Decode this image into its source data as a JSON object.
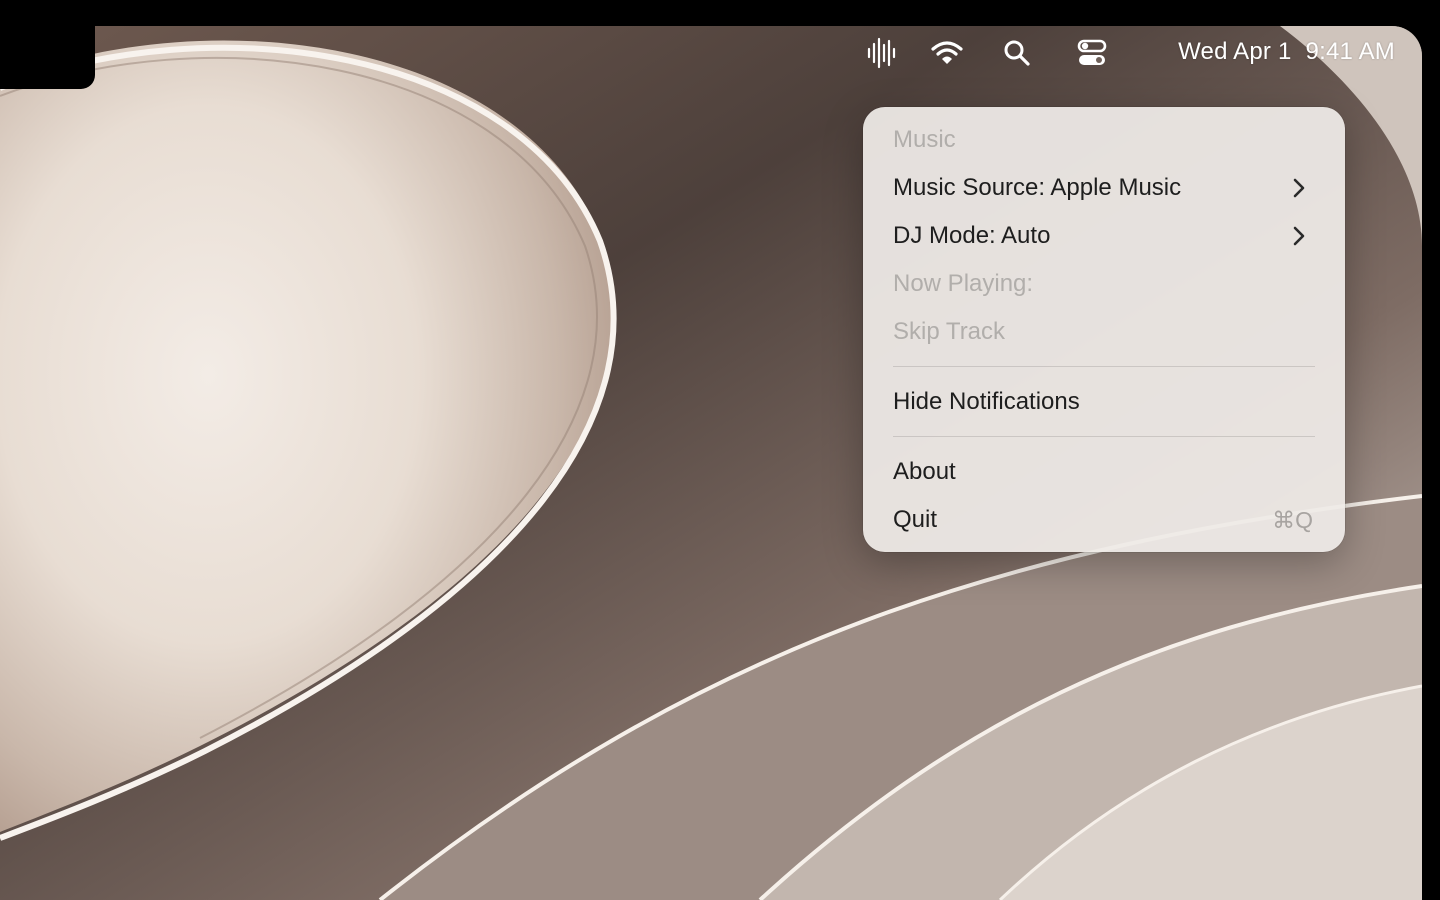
{
  "menubar": {
    "icons": [
      "waveform-icon",
      "wifi-icon",
      "search-icon",
      "control-center-icon"
    ],
    "date": "Wed Apr 1",
    "time": "9:41 AM"
  },
  "menu": {
    "header": "Music",
    "items": [
      {
        "label": "Music Source: Apple Music",
        "submenu": true,
        "enabled": true
      },
      {
        "label": "DJ Mode: Auto",
        "submenu": true,
        "enabled": true
      },
      {
        "label": "Now Playing:",
        "submenu": false,
        "enabled": false
      },
      {
        "label": "Skip Track",
        "submenu": false,
        "enabled": false
      },
      {
        "label": "Hide Notifications",
        "submenu": false,
        "enabled": true
      },
      {
        "label": "About",
        "submenu": false,
        "enabled": true
      },
      {
        "label": "Quit",
        "shortcut": "⌘Q",
        "submenu": false,
        "enabled": true
      }
    ]
  },
  "colors": {
    "menu_text": "#1e1e1e",
    "menu_disabled": "#b1aeab",
    "menubar_text": "#ffffff"
  }
}
